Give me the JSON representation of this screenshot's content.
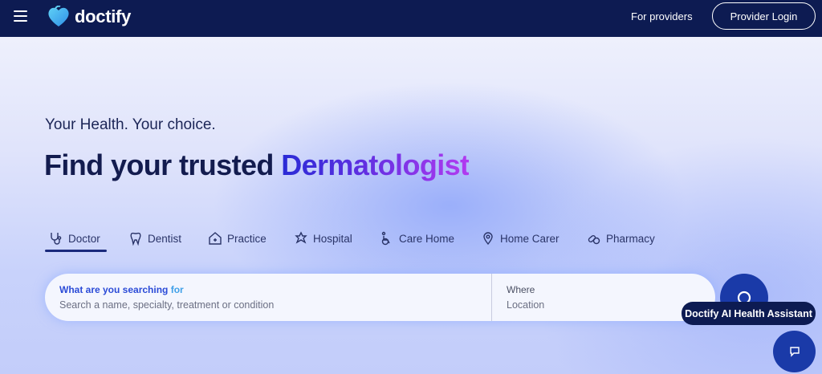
{
  "header": {
    "brand": "doctify",
    "for_providers": "For providers",
    "provider_login": "Provider Login"
  },
  "hero": {
    "subtitle": "Your Health. Your choice.",
    "headline_prefix": "Find your trusted ",
    "headline_accent": "Dermatologist"
  },
  "tabs": [
    {
      "label": "Doctor",
      "icon": "stethoscope-icon",
      "selected": true
    },
    {
      "label": "Dentist",
      "icon": "tooth-icon",
      "selected": false
    },
    {
      "label": "Practice",
      "icon": "house-icon",
      "selected": false
    },
    {
      "label": "Hospital",
      "icon": "medical-star-icon",
      "selected": false
    },
    {
      "label": "Care Home",
      "icon": "wheelchair-icon",
      "selected": false
    },
    {
      "label": "Home Carer",
      "icon": "location-pin-icon",
      "selected": false
    },
    {
      "label": "Pharmacy",
      "icon": "pills-icon",
      "selected": false
    }
  ],
  "search": {
    "label_part1": "What are you searching ",
    "label_part2": "for",
    "placeholder": "Search a name, specialty, treatment or condition",
    "where_label": "Where",
    "where_placeholder": "Location"
  },
  "assistant": {
    "tooltip": "Doctify AI Health Assistant"
  },
  "colors": {
    "header_bg": "#0d1b52",
    "accent_blue": "#1a3aa8",
    "headline_gradient_start": "#2a2bd6",
    "headline_gradient_end": "#b23bf0"
  }
}
